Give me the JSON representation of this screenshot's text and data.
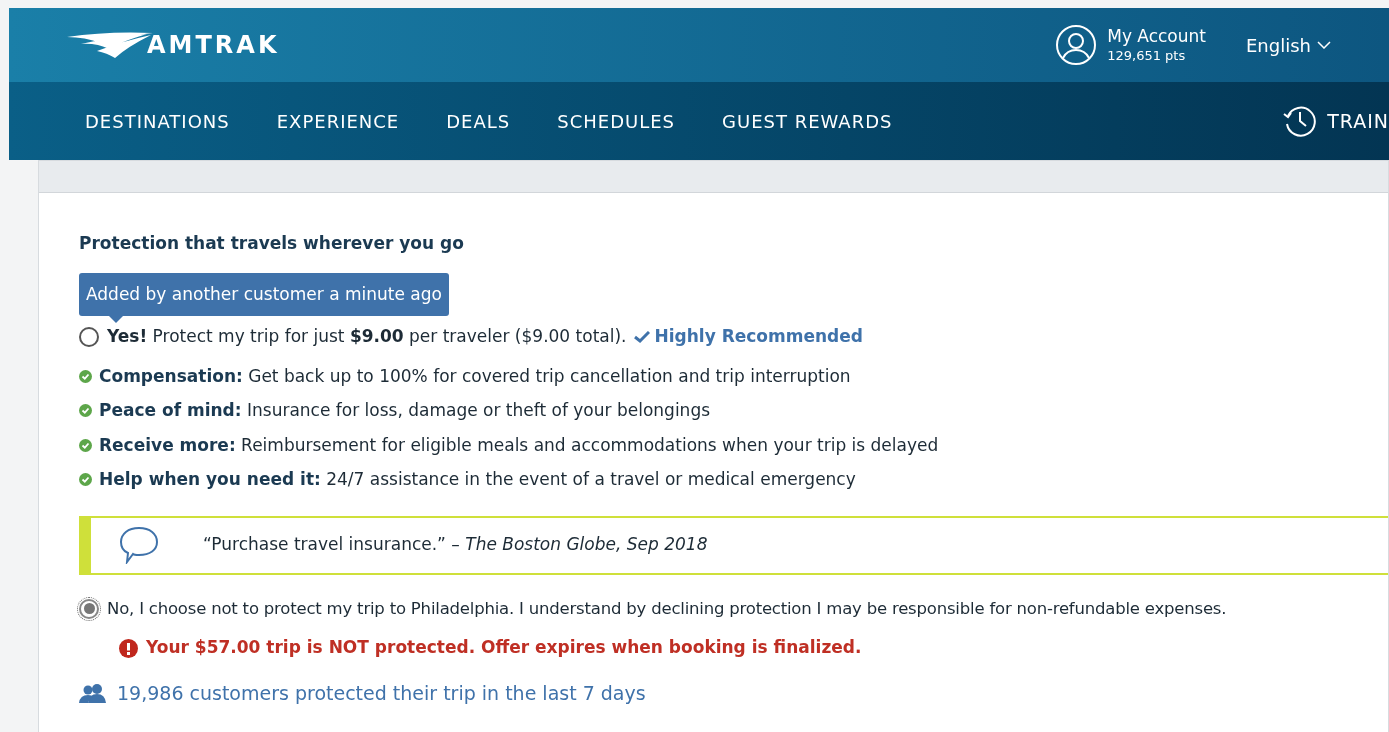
{
  "header": {
    "logo_text": "AMTRAK",
    "account": {
      "label": "My Account",
      "points": "129,651 pts"
    },
    "language": "English"
  },
  "nav": {
    "items": [
      "DESTINATIONS",
      "EXPERIENCE",
      "DEALS",
      "SCHEDULES",
      "GUEST REWARDS"
    ],
    "train_status": "TRAIN"
  },
  "section": {
    "subtitle": "Protection that travels wherever you go",
    "yes_option": {
      "tooltip": "Added by another customer a minute ago",
      "label": "**Yes!** Protect my trip for just **$9.00** per traveler ($9.00 total).",
      "badge": "Highly Recommended",
      "selected": false
    },
    "benefits": [
      {
        "title": "Compensation:",
        "text": "Get back up to 100% for covered trip cancellation and trip interruption"
      },
      {
        "title": "Peace of mind:",
        "text": "Insurance for loss, damage or theft of your belongings"
      },
      {
        "title": "Receive more:",
        "text": "Reimbursement for eligible meals and accommodations when your trip is delayed"
      },
      {
        "title": "Help when you need it:",
        "text": "24/7 assistance in the event of a travel or medical emergency"
      }
    ],
    "quote": "“Purchase travel insurance.” – *The Boston Globe, Sep 2018*",
    "no_option": {
      "label": "No, I choose not to protect my trip to Philadelphia. I understand by declining protection I may be responsible for non-refundable expenses.",
      "selected": true
    },
    "warning": "Your $57.00 trip is NOT protected. Offer expires when booking is finalized.",
    "social_proof": "19,986 customers protected their trip in the last 7 days"
  }
}
